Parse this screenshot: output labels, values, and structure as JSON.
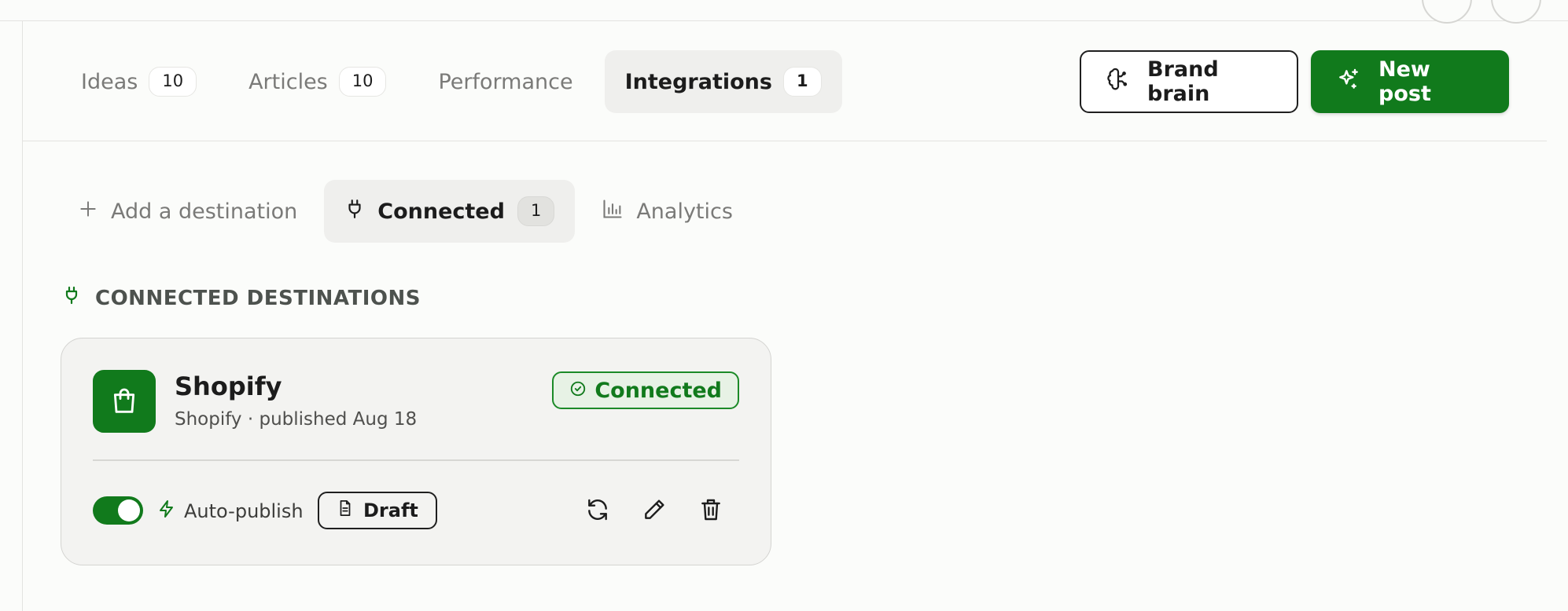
{
  "tabs": [
    {
      "label": "Ideas",
      "count": "10"
    },
    {
      "label": "Articles",
      "count": "10"
    },
    {
      "label": "Performance"
    },
    {
      "label": "Integrations",
      "count": "1",
      "active": true
    }
  ],
  "actions": {
    "brand_brain_label": "Brand brain",
    "new_post_label": "New post"
  },
  "subtabs": [
    {
      "label": "Add a destination",
      "icon": "plus-icon"
    },
    {
      "label": "Connected",
      "count": "1",
      "icon": "plug-icon",
      "active": true
    },
    {
      "label": "Analytics",
      "icon": "bar-chart-icon"
    }
  ],
  "section": {
    "title": "CONNECTED DESTINATIONS",
    "icon": "plug-icon"
  },
  "destination": {
    "name": "Shopify",
    "subtitle": "Shopify · published Aug 18",
    "status": "Connected",
    "auto_publish_label": "Auto-publish",
    "auto_publish_on": true,
    "draft_label": "Draft",
    "icon": "shopping-bag-icon"
  },
  "colors": {
    "accent": "#117a1c",
    "background": "#fbfcfa",
    "card": "#f3f3f1"
  }
}
